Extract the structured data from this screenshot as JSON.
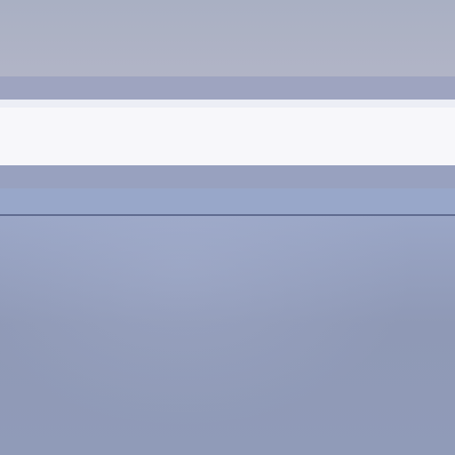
{
  "window": {
    "title": ""
  },
  "colors": {
    "top_band": "#b0b4c5",
    "strip": "#9ea4c0",
    "bar": "#f7f7fa",
    "divider": "#5f6b8f",
    "content": "#919cb8"
  }
}
